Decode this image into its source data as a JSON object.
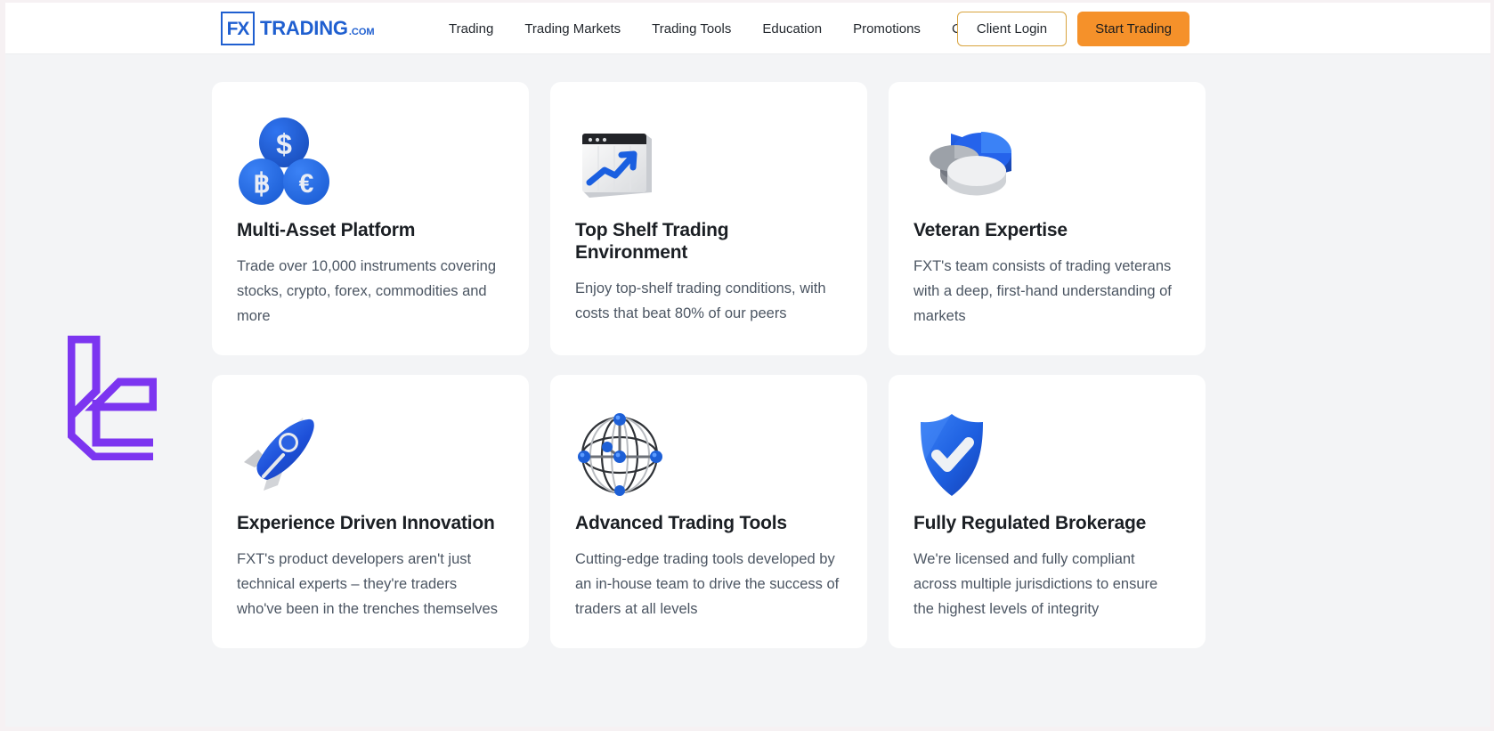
{
  "header": {
    "logo": {
      "mark": "FX",
      "word": "TRADING",
      "tld": ".COM",
      "icon_name": "fxtrading-logo"
    },
    "nav": [
      {
        "label": "Trading"
      },
      {
        "label": "Trading Markets"
      },
      {
        "label": "Trading Tools"
      },
      {
        "label": "Education"
      },
      {
        "label": "Promotions"
      },
      {
        "label": "Company"
      }
    ],
    "login_label": "Client Login",
    "start_label": "Start Trading",
    "colors": {
      "brand_blue": "#1f5fd0",
      "login_border": "#d8a33d",
      "start_bg": "#f5912a"
    }
  },
  "watermark": {
    "icon_name": "purple-bracket-logo",
    "color": "#7c35f0"
  },
  "cards": [
    {
      "icon_name": "currency-coins-icon",
      "title": "Multi-Asset Platform",
      "body": "Trade over 10,000 instruments covering stocks, crypto, forex, commodities and more"
    },
    {
      "icon_name": "chart-window-uptrend-icon",
      "title": "Top Shelf Trading Environment",
      "body": "Enjoy top-shelf trading conditions, with costs that beat 80% of our peers"
    },
    {
      "icon_name": "pie-chart-3d-icon",
      "title": "Veteran Expertise",
      "body": "FXT's team consists of trading veterans with a deep, first-hand understanding of markets"
    },
    {
      "icon_name": "rocket-icon",
      "title": "Experience Driven Innovation",
      "body": "FXT's product developers aren't just technical experts – they're traders who've been in the trenches themselves"
    },
    {
      "icon_name": "network-globe-icon",
      "title": "Advanced Trading Tools",
      "body": "Cutting-edge trading tools developed by an in-house team to drive the success of traders at all levels"
    },
    {
      "icon_name": "shield-check-icon",
      "title": "Fully Regulated Brokerage",
      "body": "We're licensed and fully compliant across multiple jurisdictions to ensure the highest levels of integrity"
    }
  ]
}
